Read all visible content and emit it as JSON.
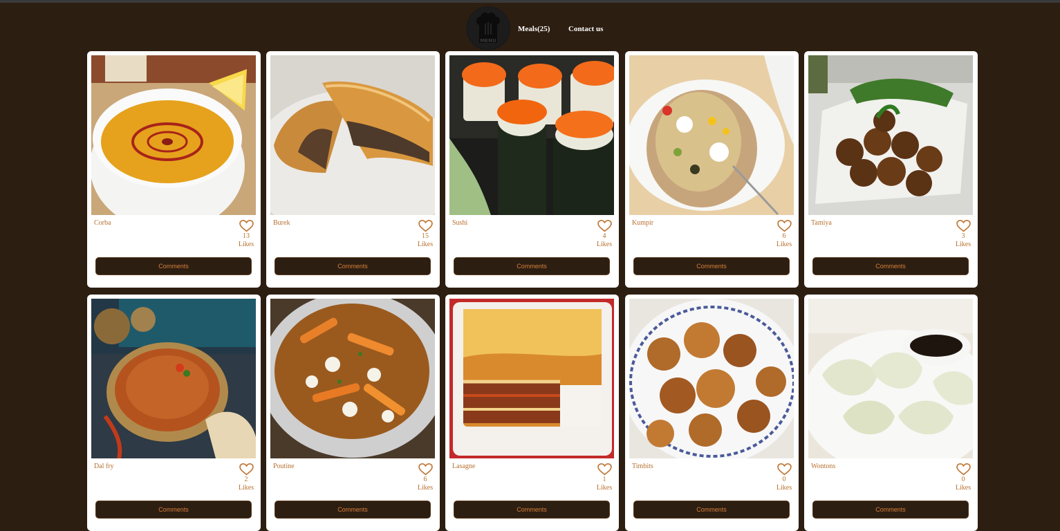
{
  "header": {
    "logo_text": "MENU",
    "nav": [
      {
        "label": "Meals(25)"
      },
      {
        "label": "Contact us"
      }
    ]
  },
  "meals": [
    {
      "name": "Corba",
      "likes": "13",
      "likes_label": "Likes",
      "comments_label": "Comments"
    },
    {
      "name": "Burek",
      "likes": "15",
      "likes_label": "Likes",
      "comments_label": "Comments"
    },
    {
      "name": "Sushi",
      "likes": "4",
      "likes_label": "Likes",
      "comments_label": "Comments"
    },
    {
      "name": "Kumpir",
      "likes": "6",
      "likes_label": "Likes",
      "comments_label": "Comments"
    },
    {
      "name": "Tamiya",
      "likes": "3",
      "likes_label": "Likes",
      "comments_label": "Comments"
    },
    {
      "name": "Dal fry",
      "likes": "2",
      "likes_label": "Likes",
      "comments_label": "Comments"
    },
    {
      "name": "Poutine",
      "likes": "6",
      "likes_label": "Likes",
      "comments_label": "Comments"
    },
    {
      "name": "Lasagne",
      "likes": "1",
      "likes_label": "Likes",
      "comments_label": "Comments"
    },
    {
      "name": "Timbits",
      "likes": "0",
      "likes_label": "Likes",
      "comments_label": "Comments"
    },
    {
      "name": "Wontons",
      "likes": "0",
      "likes_label": "Likes",
      "comments_label": "Comments"
    }
  ],
  "colors": {
    "background": "#2d1e12",
    "accent": "#b7702e",
    "card": "#ffffff"
  },
  "icons": {
    "like": "heart-icon"
  }
}
